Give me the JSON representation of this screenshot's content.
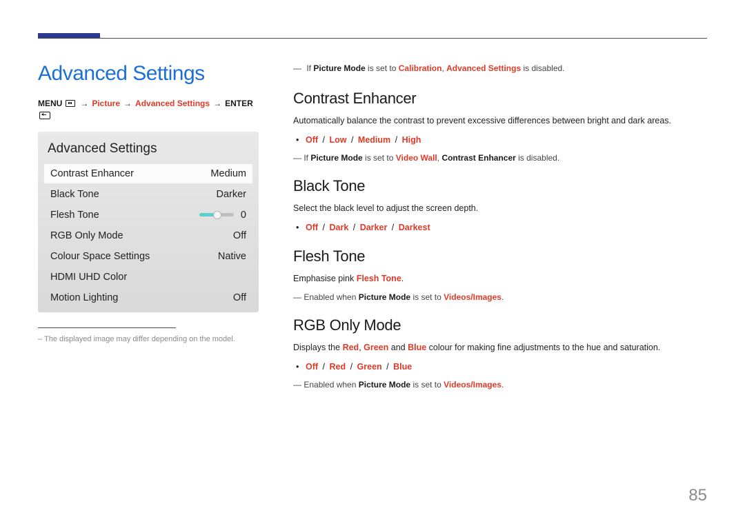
{
  "page": {
    "title": "Advanced Settings",
    "number": "85",
    "caption": "The displayed image may differ depending on the model."
  },
  "breadcrumb": {
    "menu": "MENU",
    "picture": "Picture",
    "advanced": "Advanced Settings",
    "enter": "ENTER",
    "arrow": "→"
  },
  "osd": {
    "title": "Advanced Settings",
    "rows": [
      {
        "label": "Contrast Enhancer",
        "value": "Medium"
      },
      {
        "label": "Black Tone",
        "value": "Darker"
      },
      {
        "label": "Flesh Tone",
        "value": "0"
      },
      {
        "label": "RGB Only Mode",
        "value": "Off"
      },
      {
        "label": "Colour Space Settings",
        "value": "Native"
      },
      {
        "label": "HDMI UHD Color",
        "value": ""
      },
      {
        "label": "Motion Lighting",
        "value": "Off"
      }
    ]
  },
  "topnote": {
    "if": "If ",
    "pm": "Picture Mode",
    "is_set_to": " is set to ",
    "calibration": "Calibration",
    "comma": ", ",
    "adv": "Advanced Settings",
    "disabled": " is disabled."
  },
  "contrast": {
    "heading": "Contrast Enhancer",
    "desc": "Automatically balance the contrast to prevent excessive differences between bright and dark areas.",
    "opts": {
      "off": "Off",
      "low": "Low",
      "medium": "Medium",
      "high": "High"
    },
    "note_if": "If ",
    "note_pm": "Picture Mode",
    "note_is": " is set to ",
    "note_vw": "Video Wall",
    "note_comma": ", ",
    "note_ce": "Contrast Enhancer",
    "note_dis": " is disabled."
  },
  "black": {
    "heading": "Black Tone",
    "desc": "Select the black level to adjust the screen depth.",
    "opts": {
      "off": "Off",
      "dark": "Dark",
      "darker": "Darker",
      "darkest": "Darkest"
    }
  },
  "flesh": {
    "heading": "Flesh Tone",
    "desc_pre": "Emphasise pink ",
    "desc_term": "Flesh Tone",
    "desc_post": ".",
    "note_pre": "Enabled when ",
    "note_pm": "Picture Mode",
    "note_is": " is set to ",
    "note_vi": "Videos/Images",
    "note_post": "."
  },
  "rgb": {
    "heading": "RGB Only Mode",
    "desc_pre": "Displays the ",
    "red": "Red",
    "green": "Green",
    "blue": "Blue",
    "comma": ", ",
    "and": " and ",
    "desc_post": " colour for making fine adjustments to the hue and saturation.",
    "opts": {
      "off": "Off",
      "red": "Red",
      "green": "Green",
      "blue": "Blue"
    },
    "note_pre": "Enabled when ",
    "note_pm": "Picture Mode",
    "note_is": " is set to ",
    "note_vi": "Videos/Images",
    "note_post": "."
  },
  "slash": " / ",
  "dash": "―"
}
